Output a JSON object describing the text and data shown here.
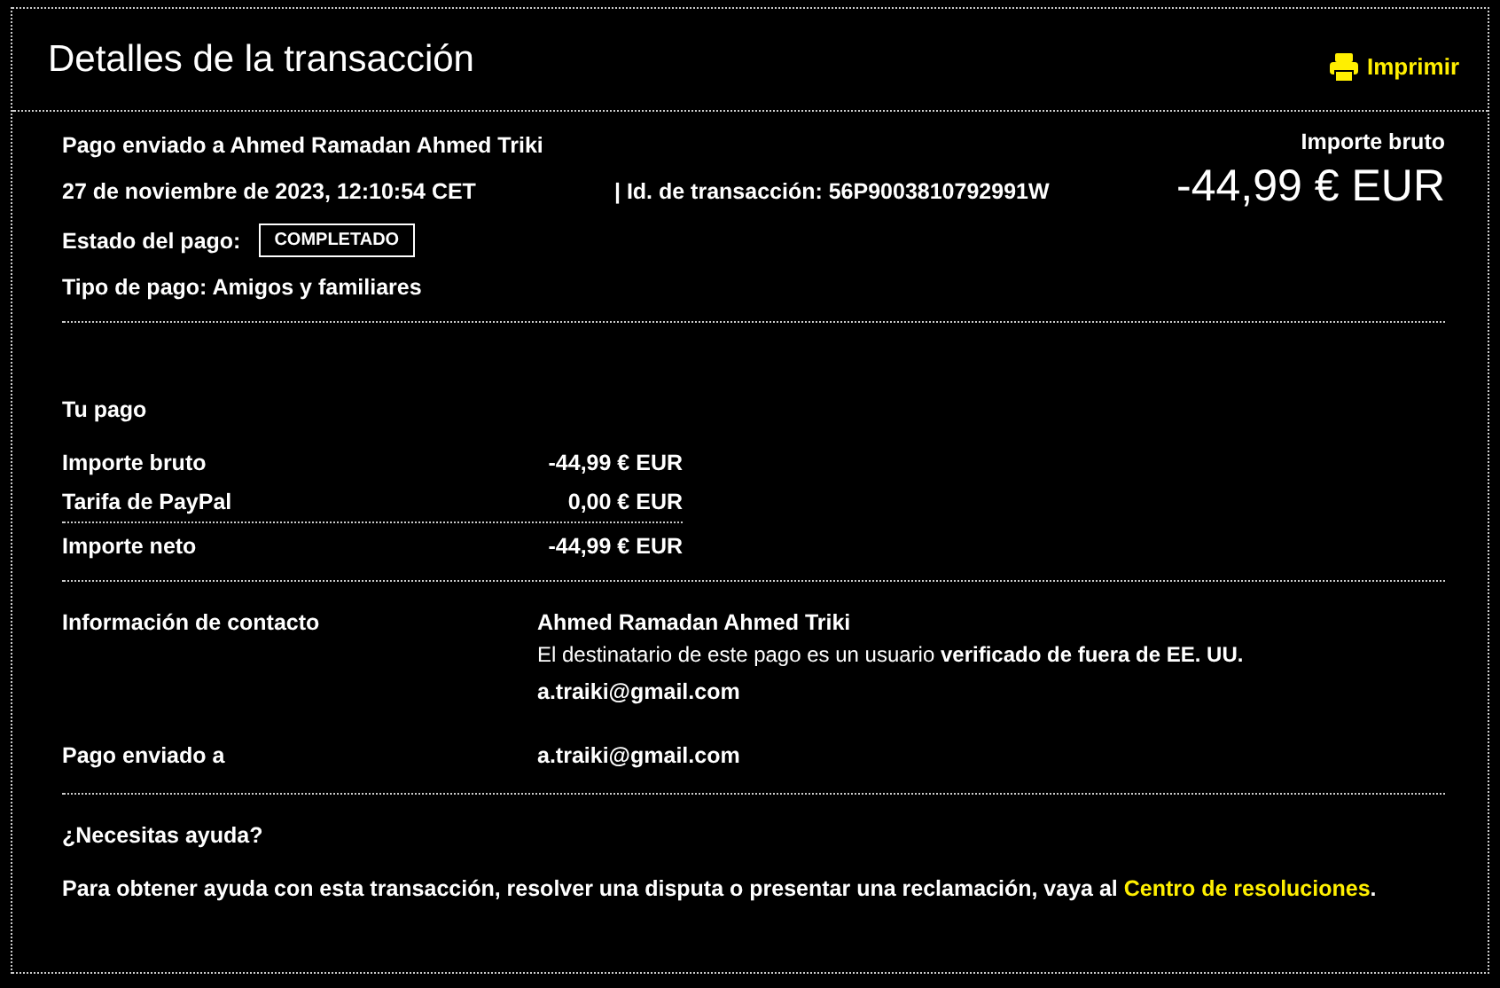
{
  "header": {
    "title": "Detalles de la transacción",
    "print_label": "Imprimir"
  },
  "summary": {
    "recipient_line": "Pago enviado a Ahmed Ramadan Ahmed Triki",
    "date": "27 de noviembre de 2023, 12:10:54 CET",
    "separator": "|",
    "transaction_id": "Id. de transacción: 56P9003810792991W",
    "status_label": "Estado del pago:",
    "status": "COMPLETADO",
    "payment_type": "Tipo de pago: Amigos y familiares",
    "amount_label": "Importe bruto",
    "amount": "-44,99 € EUR"
  },
  "payment": {
    "heading": "Tu pago",
    "rows": [
      {
        "kind": "line",
        "label": "Importe bruto",
        "value": "-44,99 € EUR"
      },
      {
        "kind": "line",
        "label": "Tarifa de PayPal",
        "value": "0,00 € EUR"
      },
      {
        "kind": "total",
        "label": "Importe neto",
        "value": "-44,99 € EUR"
      }
    ]
  },
  "contact": {
    "label": "Información de contacto",
    "name": "Ahmed Ramadan Ahmed Triki",
    "note": "El destinatario de este pago es un usuario **verificado de fuera de EE. UU.**",
    "email": "a.traiki@gmail.com"
  },
  "sent_to": {
    "label": "Pago enviado a",
    "value": "a.traiki@gmail.com"
  },
  "help": {
    "heading": "¿Necesitas ayuda?",
    "text": "Para obtener ayuda con esta transacción, resolver una disputa o presentar una reclamación, vaya al ",
    "link": "Centro de resoluciones",
    "end": "."
  }
}
